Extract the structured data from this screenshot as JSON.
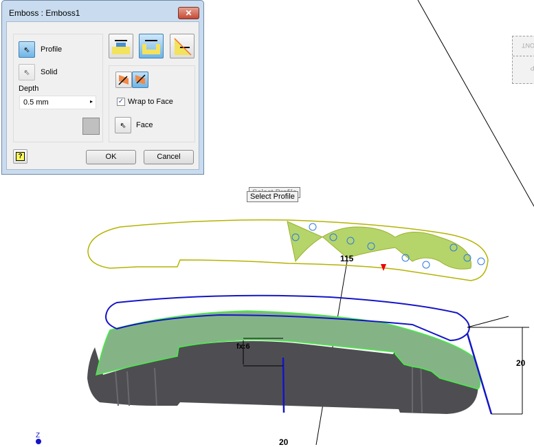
{
  "dialog": {
    "title": "Emboss : Emboss1",
    "close_icon": "close-icon",
    "profile_label": "Profile",
    "solid_label": "Solid",
    "depth_label": "Depth",
    "depth_value": "0.5 mm",
    "wrap_to_face_label": "Wrap to Face",
    "wrap_to_face_checked": true,
    "face_label": "Face",
    "ok_label": "OK",
    "cancel_label": "Cancel"
  },
  "viewport": {
    "tooltip": "Select Profile",
    "tooltip_behind": "Select Profile",
    "viewcube_front": "FRONT",
    "viewcube_top": "TOP",
    "dimensions": {
      "length": "115",
      "depth": "fx:6",
      "height_right": "20",
      "height_bottom": "20"
    },
    "axis_label": "Z"
  },
  "colors": {
    "sketch": "#b3b300",
    "profile": "#1414c8",
    "solid": "#505055",
    "face": "#84b486",
    "face_edge": "#44ee44"
  }
}
